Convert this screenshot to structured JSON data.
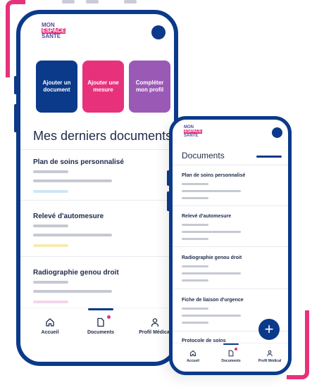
{
  "brand": {
    "logo_line1": "MON",
    "logo_line2": "ESPACE",
    "logo_line3": "SANTÉ"
  },
  "colors": {
    "primary": "#0b3a8a",
    "pink": "#e8317b",
    "violet": "#9b59b6",
    "text": "#1e2a4a"
  },
  "phone1": {
    "actions": [
      {
        "label": "Ajouter un document",
        "color": "#0b3a8a"
      },
      {
        "label": "Ajouter une mesure",
        "color": "#e8317b"
      },
      {
        "label": "Compléter mon profil",
        "color": "#9b59b6"
      }
    ],
    "section_title": "Mes derniers documents",
    "documents": [
      {
        "title": "Plan de soins personnalisé",
        "tag_color": "#cfe6f5"
      },
      {
        "title": "Relevé d'automesure",
        "tag_color": "#f7ebb4"
      },
      {
        "title": "Radiographie genou droit",
        "tag_color": "#f3d6ec"
      }
    ],
    "nav": [
      {
        "label": "Accueil",
        "icon": "home-icon"
      },
      {
        "label": "Documents",
        "icon": "document-icon",
        "active": true
      },
      {
        "label": "Profil Médical",
        "icon": "user-icon"
      }
    ]
  },
  "phone2": {
    "title": "Documents",
    "documents": [
      {
        "title": "Plan de soins personnalisé"
      },
      {
        "title": "Relevé d'automesure"
      },
      {
        "title": "Radiographie genou droit"
      },
      {
        "title": "Fiche de liaison d'urgence"
      },
      {
        "title": "Protocole de soins"
      }
    ],
    "fab_label": "+",
    "nav": [
      {
        "label": "Accueil",
        "icon": "home-icon"
      },
      {
        "label": "Documents",
        "icon": "document-icon",
        "active": true
      },
      {
        "label": "Profil Médical",
        "icon": "user-icon"
      }
    ]
  }
}
